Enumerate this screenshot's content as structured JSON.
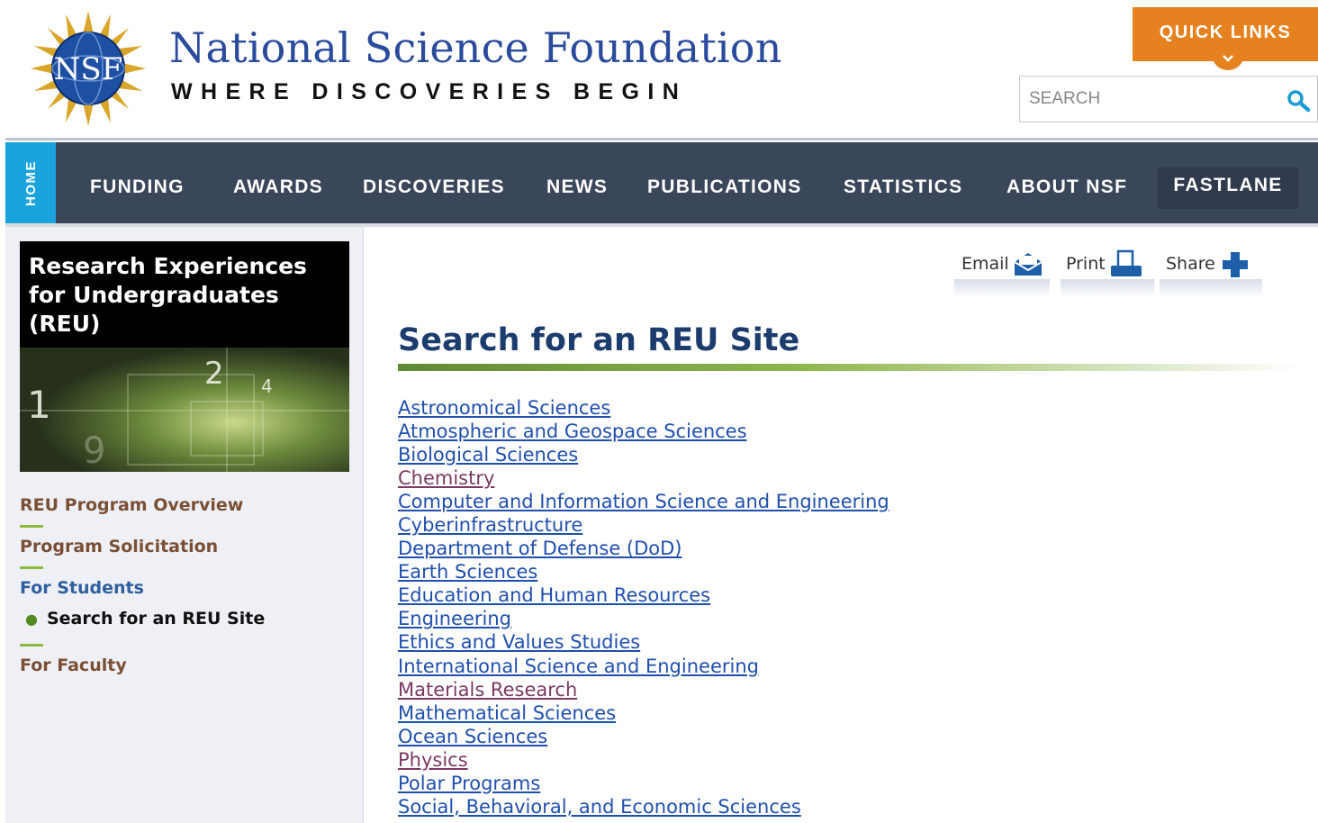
{
  "header": {
    "org_name": "National Science Foundation",
    "tagline": "WHERE DISCOVERIES BEGIN",
    "logo_text": "NSF",
    "quick_links_label": "QUICK LINKS",
    "search_placeholder": "SEARCH"
  },
  "nav": {
    "home_label": "HOME",
    "items": [
      "FUNDING",
      "AWARDS",
      "DISCOVERIES",
      "NEWS",
      "PUBLICATIONS",
      "STATISTICS",
      "ABOUT NSF"
    ],
    "fastlane_label": "FASTLANE"
  },
  "sidebar": {
    "program_title": "Research Experiences for Undergraduates (REU)",
    "links": {
      "overview": "REU Program Overview",
      "solicitation": "Program Solicitation",
      "for_students": "For Students",
      "current": "Search for an REU Site",
      "for_faculty": "For Faculty"
    }
  },
  "share": {
    "email": "Email",
    "print": "Print",
    "share": "Share"
  },
  "main": {
    "title": "Search for an REU Site",
    "sites": [
      "Astronomical Sciences",
      "Atmospheric and Geospace Sciences",
      "Biological Sciences",
      "Chemistry",
      "Computer and Information Science and Engineering",
      "Cyberinfrastructure",
      "Department of Defense (DoD)",
      "Earth Sciences",
      "Education and Human Resources",
      "Engineering",
      "Ethics and Values Studies",
      "International Science and Engineering",
      "Materials Research",
      "Mathematical Sciences",
      "Ocean Sciences",
      "Physics",
      "Polar Programs",
      "Social, Behavioral, and Economic Sciences"
    ],
    "visited_links": [
      "Chemistry",
      "Materials Research",
      "Physics"
    ]
  },
  "colors": {
    "brand_blue": "#2a4a9c",
    "nav_bg": "#3a4659",
    "home_tab": "#1aa3dc",
    "quick_links": "#e6811f",
    "link": "#1f4fae",
    "visited_link": "#7a3a62",
    "accent_green": "#8cba3c"
  },
  "icons": {
    "logo": "nsf-globe-logo",
    "search": "search-icon",
    "chevron": "chevron-down-icon",
    "email": "email-icon",
    "print": "print-icon",
    "share": "plus-share-icon"
  }
}
